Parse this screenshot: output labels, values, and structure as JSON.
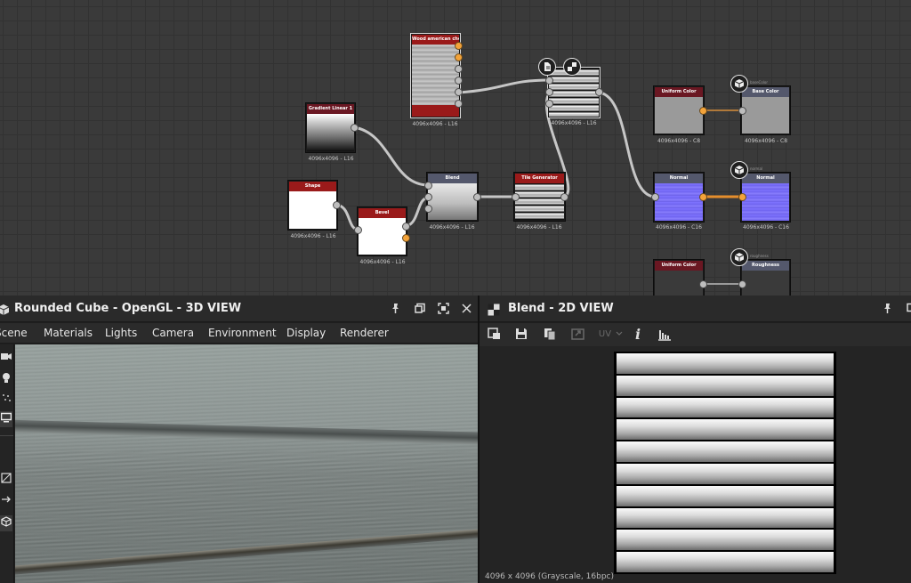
{
  "graph": {
    "nodes": {
      "wood": {
        "title": "Wood american cherry",
        "caption": "4096x4096 - L16"
      },
      "gradient": {
        "title": "Gradient Linear 1",
        "caption": "4096x4096 - L16"
      },
      "shape": {
        "title": "Shape",
        "caption": "4096x4096 - L16"
      },
      "bevel": {
        "title": "Bevel",
        "caption": "4096x4096 - L16"
      },
      "blend": {
        "title": "Blend",
        "caption": "4096x4096 - L16"
      },
      "tile": {
        "title": "Tile Generator",
        "caption": "4096x4096 - L16"
      },
      "blend2": {
        "caption": "4096x4096 - L16"
      },
      "uniform1": {
        "title": "Uniform Color",
        "caption": "4096x4096 - C8"
      },
      "basecolor": {
        "title": "Base Color",
        "caption": "4096x4096 - C8",
        "tag": "baseColor"
      },
      "normal1": {
        "title": "Normal",
        "caption": "4096x4096 - C16"
      },
      "normal2": {
        "title": "Normal",
        "caption": "4096x4096 - C16",
        "tag": "normal"
      },
      "uniform2": {
        "title": "Uniform Color"
      },
      "roughness": {
        "title": "Roughness",
        "tag": "roughness"
      }
    }
  },
  "panel3d": {
    "title": "Rounded Cube - OpenGL - 3D VIEW",
    "menu": [
      "Scene",
      "Materials",
      "Lights",
      "Camera",
      "Environment",
      "Display",
      "Renderer"
    ],
    "sidebar_icons": [
      "camera-icon",
      "light-bulb-icon",
      "sparkle-icon",
      "display-icon",
      "cube-frame-icon",
      "arrow-right-icon",
      "cube-icon"
    ]
  },
  "panel2d": {
    "title": "Blend - 2D VIEW",
    "uv_label": "UV",
    "info_label": "i",
    "status": "4096 x 4096 (Grayscale, 16bpc)",
    "strip_count": 10
  },
  "colors": {
    "accent_orange": "#f3a33a",
    "node_header_red": "#9a1a1a",
    "normal_blue": "#7f73ff"
  }
}
